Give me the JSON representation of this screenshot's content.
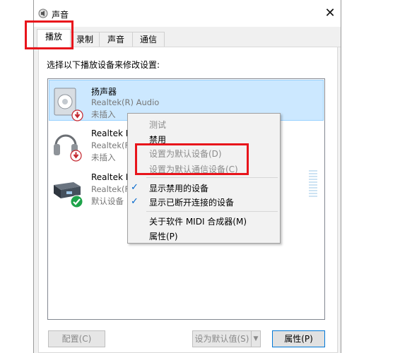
{
  "window": {
    "title": "声音",
    "close_glyph": "✕"
  },
  "tabs": [
    {
      "label": "播放",
      "active": true
    },
    {
      "label": "录制",
      "active": false
    },
    {
      "label": "声音",
      "active": false
    },
    {
      "label": "通信",
      "active": false
    }
  ],
  "instruction": "选择以下播放设备来修改设置:",
  "devices": [
    {
      "name": "扬声器",
      "driver": "Realtek(R) Audio",
      "status": "未插入",
      "icon": "speaker-icon",
      "badge": "disconnected-badge-icon"
    },
    {
      "name": "Realtek H",
      "driver": "Realtek(F",
      "status": "未插入",
      "icon": "headphones-icon",
      "badge": "disconnected-badge-icon"
    },
    {
      "name": "Realtek D",
      "driver": "Realtek(F",
      "status": "默认设备",
      "icon": "digital-output-icon",
      "badge": "default-check-badge-icon"
    }
  ],
  "context_menu": {
    "items": [
      {
        "label": "测试",
        "disabled": true,
        "checked": false
      },
      {
        "label": "禁用",
        "disabled": false,
        "checked": false
      },
      {
        "label": "设置为默认设备(D)",
        "disabled": true,
        "checked": false
      },
      {
        "label": "设置为默认通信设备(C)",
        "disabled": true,
        "checked": false
      },
      {
        "label": "显示禁用的设备",
        "disabled": false,
        "checked": true
      },
      {
        "label": "显示已断开连接的设备",
        "disabled": false,
        "checked": true
      },
      {
        "label": "关于软件 MIDI 合成器(M)",
        "disabled": false,
        "checked": false
      },
      {
        "label": "属性(P)",
        "disabled": false,
        "checked": false
      }
    ]
  },
  "buttons": {
    "configure": "配置(C)",
    "set_default": "设为默认值(S)",
    "dropdown_glyph": "▼",
    "properties": "属性(P)"
  },
  "colors": {
    "highlight": "#cce8ff",
    "annotation": "#e8141b",
    "accent": "#0078d7"
  }
}
